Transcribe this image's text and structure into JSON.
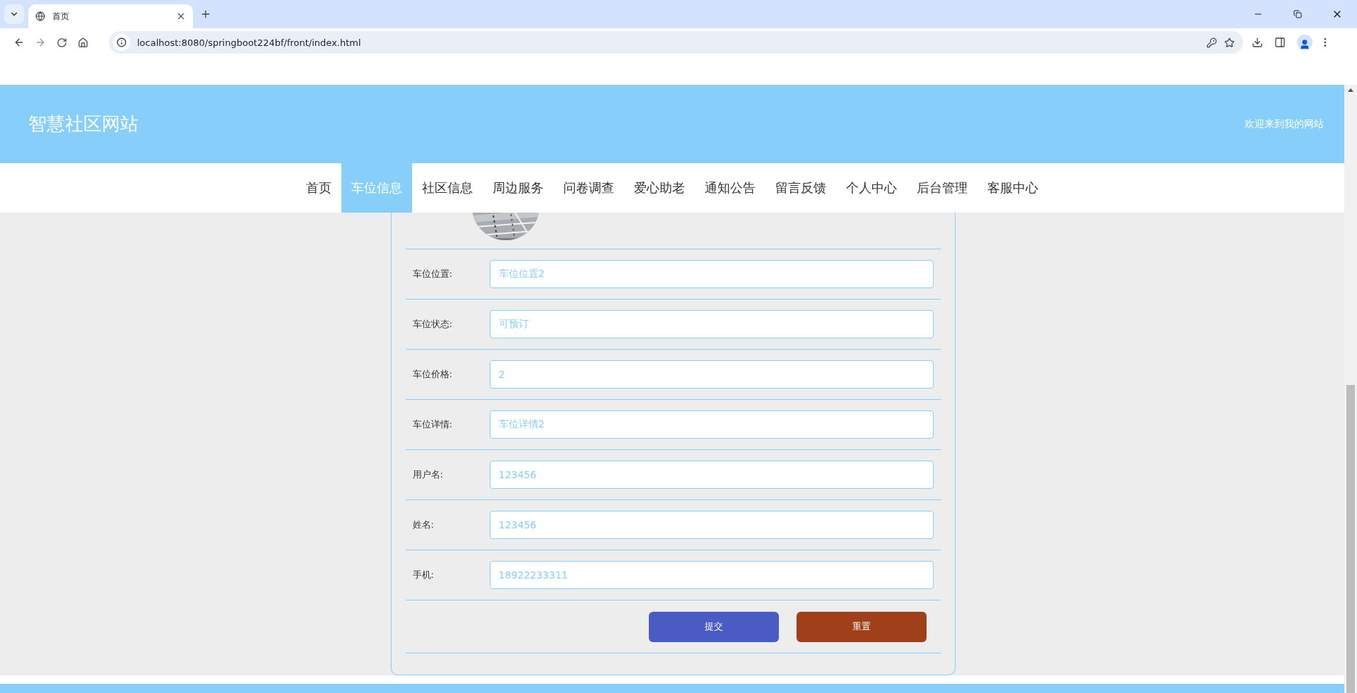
{
  "browser": {
    "tab_title": "首页",
    "url": "localhost:8080/springboot224bf/front/index.html"
  },
  "header": {
    "site_title": "智慧社区网站",
    "welcome": "欢迎来到我的网站"
  },
  "nav": [
    {
      "label": "首页",
      "selected": false
    },
    {
      "label": "车位信息",
      "selected": true
    },
    {
      "label": "社区信息",
      "selected": false
    },
    {
      "label": "周边服务",
      "selected": false
    },
    {
      "label": "问卷调查",
      "selected": false
    },
    {
      "label": "爱心助老",
      "selected": false
    },
    {
      "label": "通知公告",
      "selected": false
    },
    {
      "label": "留言反馈",
      "selected": false
    },
    {
      "label": "个人中心",
      "selected": false
    },
    {
      "label": "后台管理",
      "selected": false
    },
    {
      "label": "客服中心",
      "selected": false
    }
  ],
  "form": {
    "fields": [
      {
        "label": "车位位置:",
        "value": "车位位置2"
      },
      {
        "label": "车位状态:",
        "value": "可预订"
      },
      {
        "label": "车位价格:",
        "value": "2"
      },
      {
        "label": "车位详情:",
        "value": "车位详情2"
      },
      {
        "label": "用户名:",
        "value": "123456"
      },
      {
        "label": "姓名:",
        "value": "123456"
      },
      {
        "label": "手机:",
        "value": "18922233311"
      }
    ],
    "buttons": [
      {
        "label": "提交",
        "kind": "submit"
      },
      {
        "label": "重置",
        "kind": "reset"
      }
    ]
  }
}
